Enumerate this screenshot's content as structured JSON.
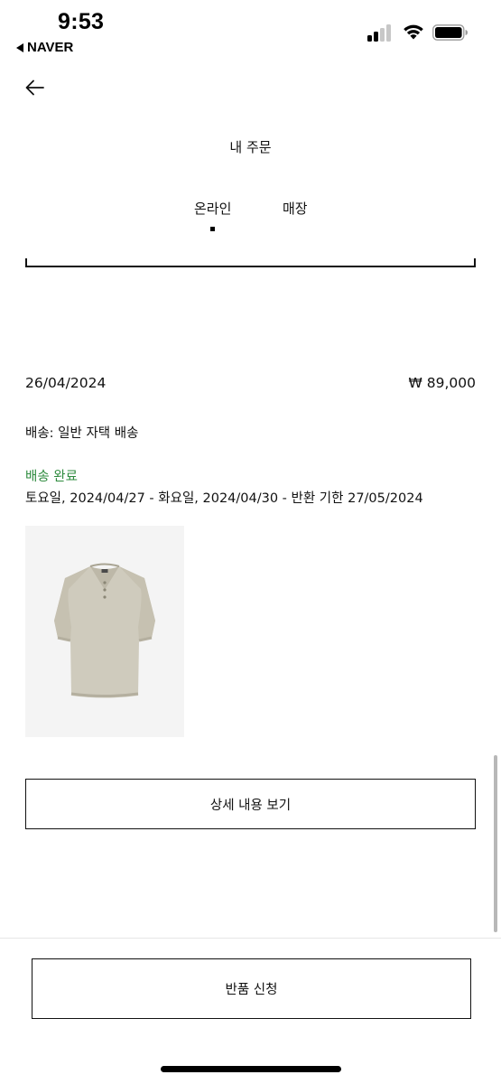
{
  "status_bar": {
    "time": "9:53",
    "back_app_label": "NAVER",
    "signal_icon": "cellular-signal-icon",
    "wifi_icon": "wifi-icon",
    "battery_icon": "battery-icon"
  },
  "nav": {
    "back_icon": "arrow-left-icon"
  },
  "header": {
    "title": "내 주문"
  },
  "tabs": [
    {
      "label": "온라인",
      "selected": true
    },
    {
      "label": "매장",
      "selected": false
    }
  ],
  "order": {
    "date": "26/04/2024",
    "price": "₩ 89,000",
    "shipping_method": "배송: 일반 자택 배송",
    "status": "배송 완료",
    "dates": "토요일, 2024/04/27 - 화요일, 2024/04/30 - 반환 기한 27/05/2024",
    "product_image": "beige-knit-polo-shirt",
    "detail_button_label": "상세 내용 보기"
  },
  "footer": {
    "return_button_label": "반품 신청"
  },
  "colors": {
    "status_green": "#2e8b3e",
    "text": "#111111",
    "product_beige": "#cfcbbd",
    "image_background": "#f4f4f4"
  }
}
